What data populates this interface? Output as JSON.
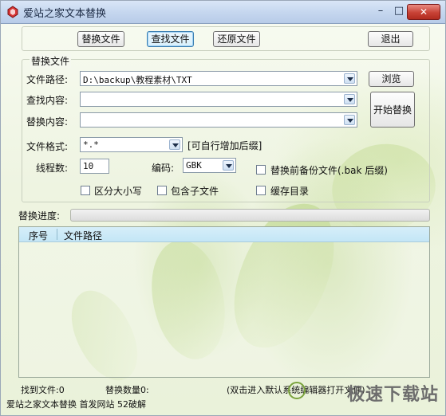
{
  "window": {
    "title": "爱站之家文本替换"
  },
  "top_buttons": {
    "replace_file": "替换文件",
    "find_file": "查找文件",
    "restore_file": "还原文件",
    "exit": "退出"
  },
  "replace_group": {
    "title": "替换文件",
    "file_path_label": "文件路径:",
    "file_path_value": "D:\\backup\\教程素材\\TXT",
    "find_content_label": "查找内容:",
    "find_content_value": "",
    "replace_content_label": "替换内容:",
    "replace_content_value": "",
    "browse_button": "浏览",
    "start_replace_button": "开始替换",
    "file_format_label": "文件格式:",
    "file_format_value": "*.*",
    "file_format_hint": "[可自行增加后缀]",
    "threads_label": "线程数:",
    "threads_value": "10",
    "encoding_label": "编码:",
    "encoding_value": "GBK",
    "backup_label": "替换前备份文件(.bak 后缀)",
    "case_label": "区分大小写",
    "subfolder_label": "包含子文件",
    "cache_label": "缓存目录"
  },
  "progress": {
    "label": "替换进度:",
    "percent": 0
  },
  "table": {
    "columns": [
      "序号",
      "文件路径"
    ],
    "rows": []
  },
  "status_bar": {
    "found_files": "找到文件:0",
    "replace_count": "替换数量0:",
    "hint": "(双击进入默认系统编辑器打开文件)"
  },
  "footer": {
    "text": "爱站之家文本替换 首发网站 52破解"
  },
  "watermark": {
    "text": "极速下载站"
  },
  "colors": {
    "title_bar": "#c6d7ef",
    "close_button": "#c84236",
    "list_header": "#c4e6f6"
  }
}
